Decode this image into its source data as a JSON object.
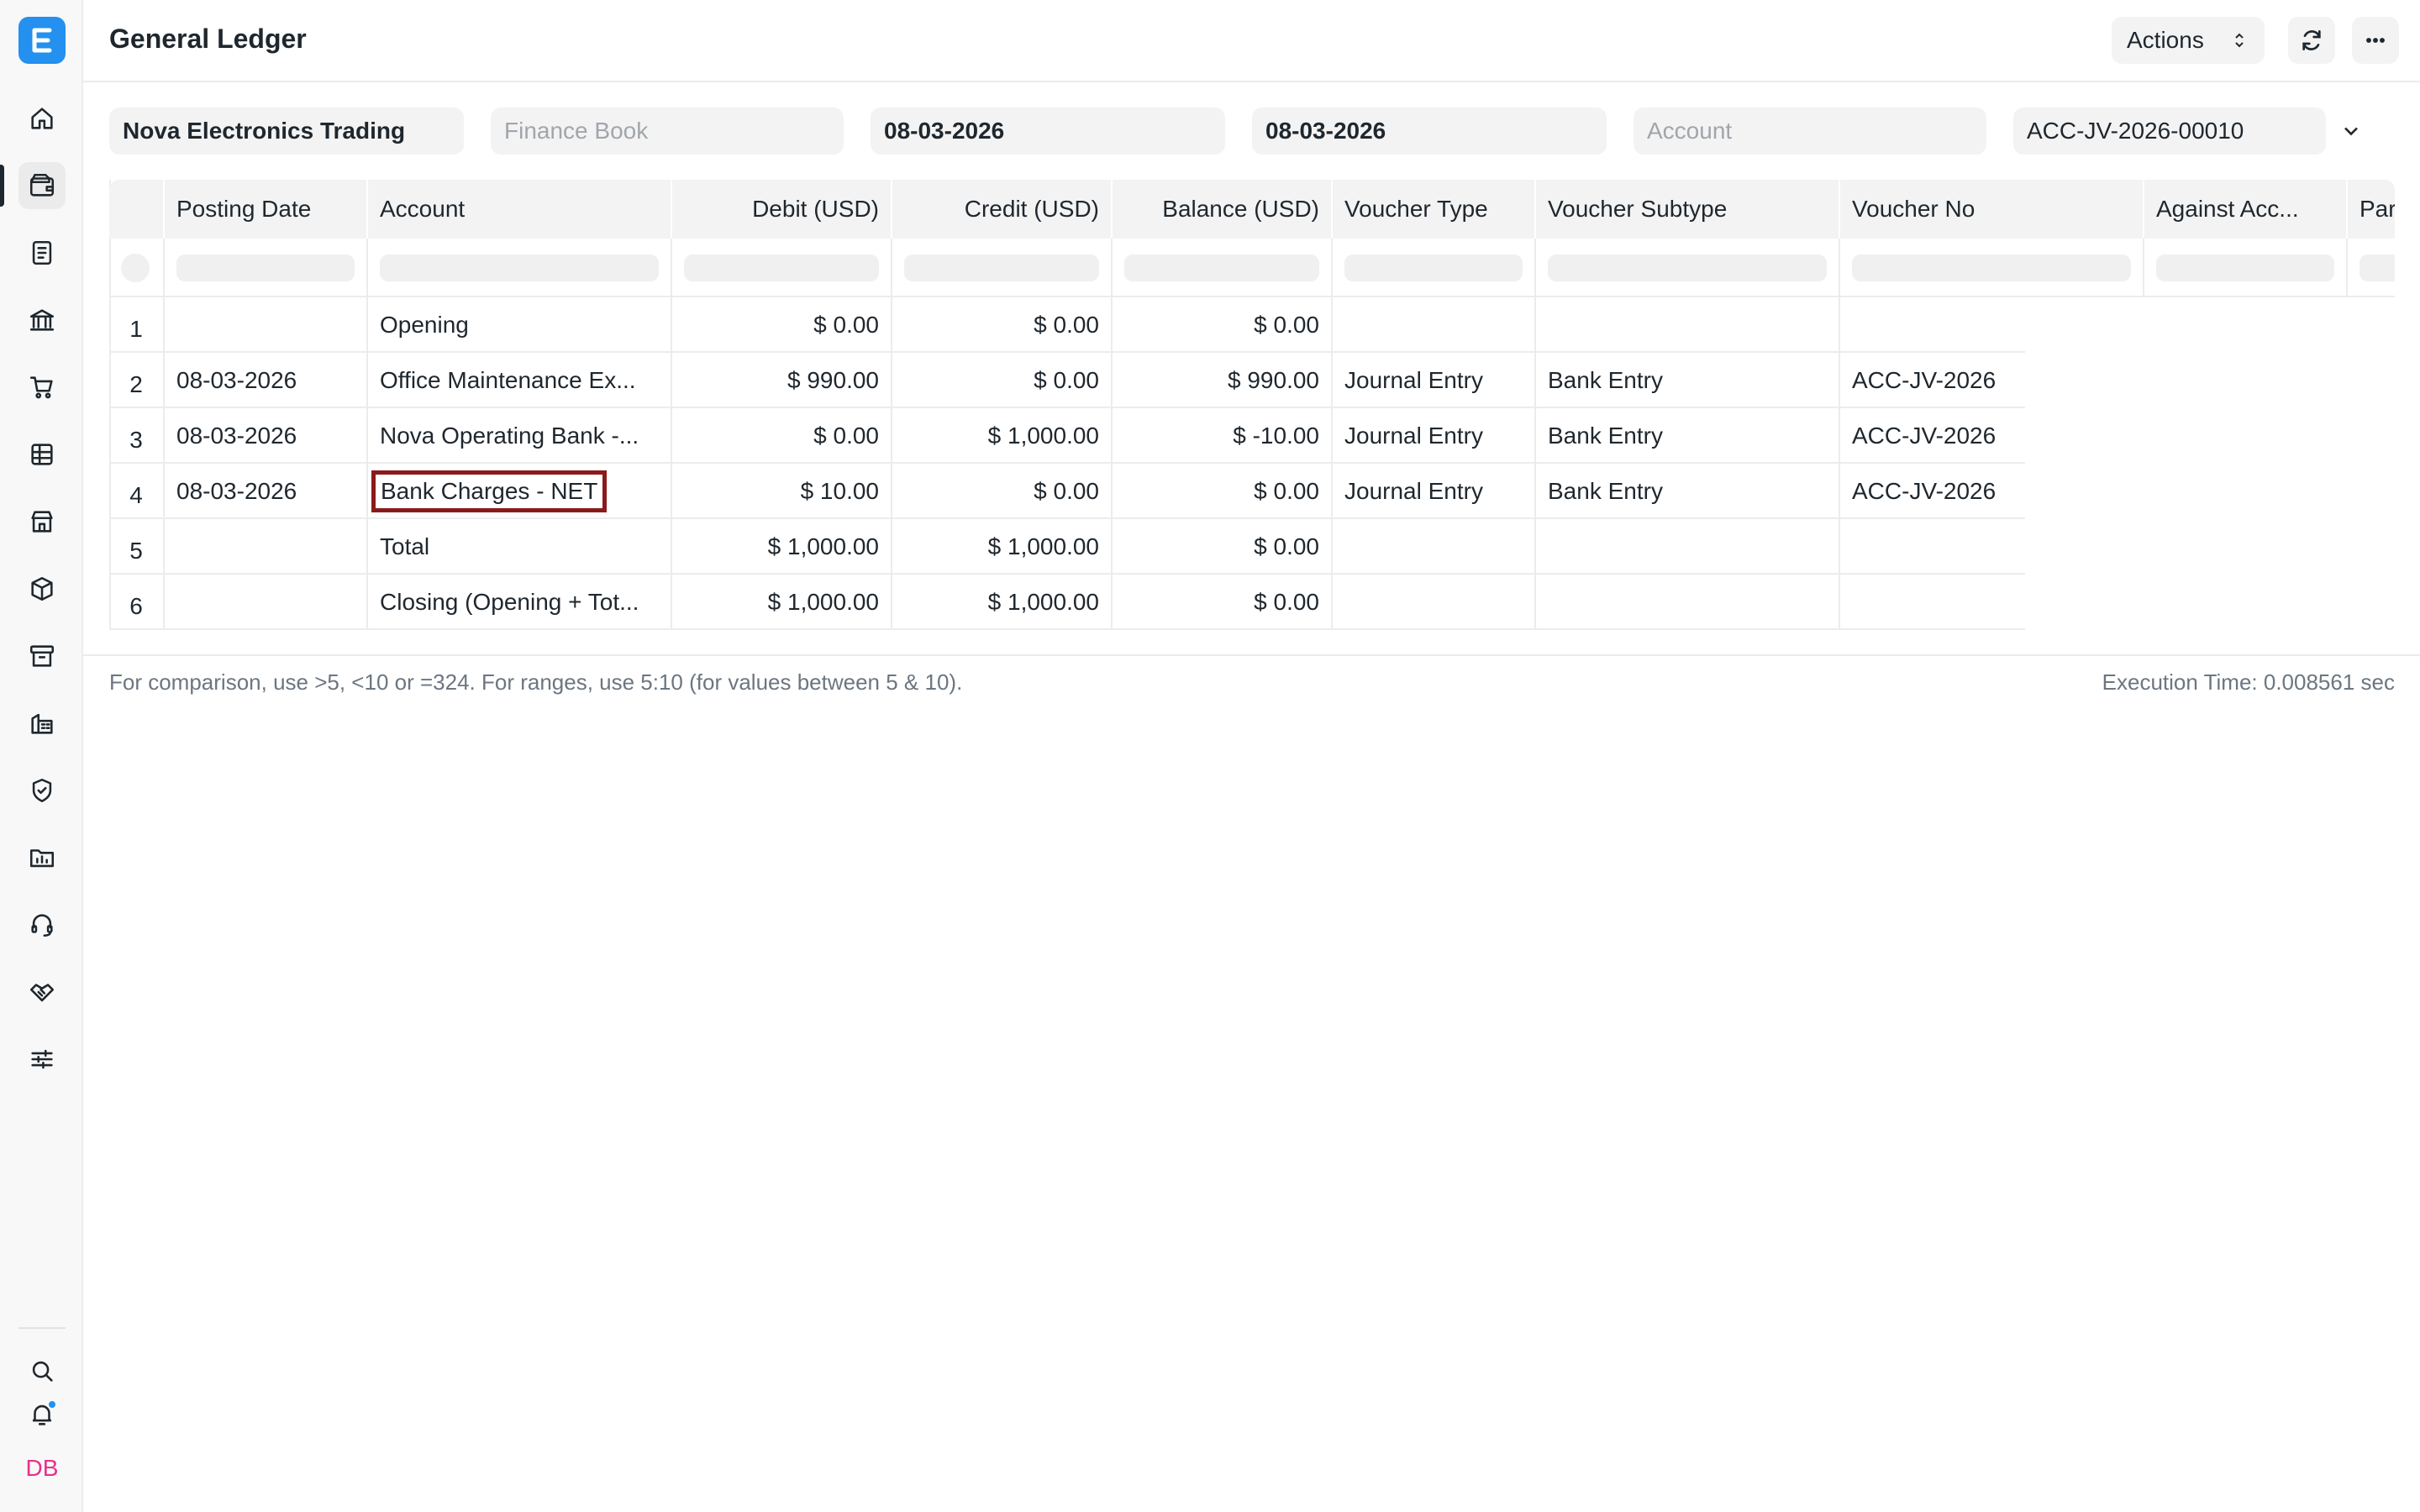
{
  "header": {
    "title": "General Ledger",
    "actions_label": "Actions"
  },
  "filters": {
    "company": "Nova Electronics Trading",
    "finance_book_placeholder": "Finance Book",
    "from_date": "08-03-2026",
    "to_date": "08-03-2026",
    "account_placeholder": "Account",
    "voucher_no": "ACC-JV-2026-00010"
  },
  "table": {
    "columns": [
      "Posting Date",
      "Account",
      "Debit (USD)",
      "Credit (USD)",
      "Balance (USD)",
      "Voucher Type",
      "Voucher Subtype",
      "Voucher No",
      "Against Acc...",
      "Par"
    ],
    "rows": [
      {
        "idx": "1",
        "posting_date": "",
        "account": "Opening",
        "debit": "$ 0.00",
        "credit": "$ 0.00",
        "balance": "$ 0.00",
        "voucher_type": "",
        "voucher_subtype": "",
        "voucher_no": ""
      },
      {
        "idx": "2",
        "posting_date": "08-03-2026",
        "account": "Office Maintenance Ex...",
        "debit": "$ 990.00",
        "credit": "$ 0.00",
        "balance": "$ 990.00",
        "voucher_type": "Journal Entry",
        "voucher_subtype": "Bank Entry",
        "voucher_no": "ACC-JV-2026"
      },
      {
        "idx": "3",
        "posting_date": "08-03-2026",
        "account": "Nova Operating Bank -...",
        "debit": "$ 0.00",
        "credit": "$ 1,000.00",
        "balance": "$ -10.00",
        "voucher_type": "Journal Entry",
        "voucher_subtype": "Bank Entry",
        "voucher_no": "ACC-JV-2026"
      },
      {
        "idx": "4",
        "posting_date": "08-03-2026",
        "account": "Bank Charges - NET",
        "debit": "$ 10.00",
        "credit": "$ 0.00",
        "balance": "$ 0.00",
        "voucher_type": "Journal Entry",
        "voucher_subtype": "Bank Entry",
        "voucher_no": "ACC-JV-2026"
      },
      {
        "idx": "5",
        "posting_date": "",
        "account": "Total",
        "debit": "$ 1,000.00",
        "credit": "$ 1,000.00",
        "balance": "$ 0.00",
        "voucher_type": "",
        "voucher_subtype": "",
        "voucher_no": ""
      },
      {
        "idx": "6",
        "posting_date": "",
        "account": "Closing (Opening + Tot...",
        "debit": "$ 1,000.00",
        "credit": "$ 1,000.00",
        "balance": "$ 0.00",
        "voucher_type": "",
        "voucher_subtype": "",
        "voucher_no": ""
      }
    ]
  },
  "footer": {
    "note": "For comparison, use >5, <10 or =324. For ranges, use 5:10 (for values between 5 & 10).",
    "execution_time": "Execution Time: 0.008561 sec"
  },
  "user": {
    "initials": "DB"
  },
  "colors": {
    "brand": "#2490ef",
    "highlight": "#8b1a1a",
    "avatar": "#e8318a"
  }
}
